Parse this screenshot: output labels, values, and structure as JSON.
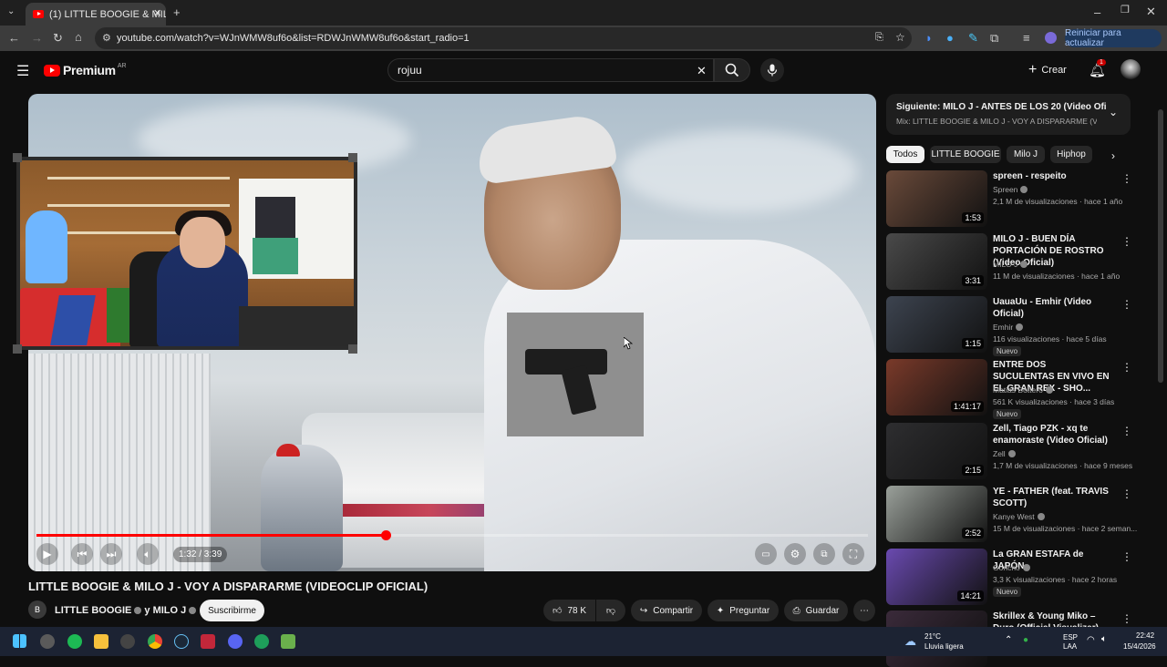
{
  "browser": {
    "tab_title": "(1) LITTLE BOOGIE & MILO J - V",
    "url": "youtube.com/watch?v=WJnWMW8uf6o&list=RDWJnWMW8uf6o&start_radio=1",
    "update_label": "Reiniciar para actualizar"
  },
  "header": {
    "logo_text": "Premium",
    "logo_region": "AR",
    "search_value": "rojuu",
    "create_label": "Crear",
    "notifications_count": "1"
  },
  "video": {
    "current_time": "1:32 / 3:39",
    "progress": 0.42,
    "title": "LITTLE BOOGIE & MILO J - VOY A DISPARARME (VIDEOCLIP OFICIAL)",
    "channel": "LITTLE BOOGIE",
    "channel_and": "y MILO J",
    "subscribe_label": "Suscribirme",
    "likes": "78 K",
    "share_label": "Compartir",
    "ask_label": "Preguntar",
    "save_label": "Guardar"
  },
  "sidebar": {
    "up_next": "Siguiente: MILO J - ANTES DE LOS 20 (Video Oficial)",
    "mix": "Mix: LITTLE BOOGIE & MILO J - VOY A DISPARARME (VIDEO...",
    "chips": [
      "Todos",
      "LITTLE BOOGIE",
      "Milo J",
      "Hiphop"
    ],
    "items": [
      {
        "title": "spreen - respeito",
        "channel": "Spreen",
        "meta": "2,1 M de visualizaciones · hace 1 año",
        "duration": "1:53",
        "new": "",
        "thumb": "#6a4a3a"
      },
      {
        "title": "MILO J - BUEN DÍA PORTACIÓN DE ROSTRO (Video Oficial)",
        "channel": "MILO J",
        "meta": "11 M de visualizaciones · hace 1 año",
        "duration": "3:31",
        "new": "",
        "thumb": "#4a4a4a"
      },
      {
        "title": "UauaUu - Emhir (Video Oficial)",
        "channel": "Emhir",
        "meta": "116 visualizaciones · hace 5 días",
        "duration": "1:15",
        "new": "Nuevo",
        "thumb": "#3d4450"
      },
      {
        "title": "ENTRE DOS SUCULENTAS EN VIVO EN EL GRAN REX - SHO...",
        "channel": "Matias Bottero",
        "meta": "561 K visualizaciones · hace 3 días",
        "duration": "1:41:17",
        "new": "Nuevo",
        "thumb": "#7a3a2a"
      },
      {
        "title": "Zell, Tiago PZK - xq te enamoraste (Video Oficial)",
        "channel": "Zell",
        "meta": "1,7 M de visualizaciones · hace 9 meses",
        "duration": "2:15",
        "new": "",
        "thumb": "#2e2e30"
      },
      {
        "title": "YE - FATHER (feat. TRAVIS SCOTT)",
        "channel": "Kanye West",
        "meta": "15 M de visualizaciones · hace 2 seman...",
        "duration": "2:52",
        "new": "",
        "thumb": "#9aa09a"
      },
      {
        "title": "La GRAN ESTAFA de JAPÓN",
        "channel": "Goncho",
        "meta": "3,3 K visualizaciones · hace 2 horas",
        "duration": "14:21",
        "new": "Nuevo",
        "thumb": "#6a4ab0"
      },
      {
        "title": "Skrillex & Young Miko – Duro (Official Visualizer)",
        "channel": "",
        "meta": "",
        "duration": "",
        "new": "",
        "thumb": "#3a2a3a"
      }
    ]
  },
  "taskbar": {
    "weather_temp": "21°C",
    "weather_desc": "Lluvia ligera",
    "lang1": "ESP",
    "lang2": "LAA",
    "time": "22:42",
    "date": "15/4/2026"
  },
  "colors": {
    "accent": "#ff0000",
    "background": "#0f0f0f"
  }
}
